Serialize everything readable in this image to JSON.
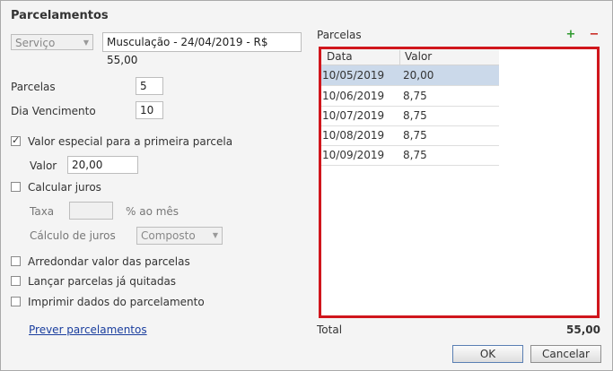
{
  "dialog": {
    "title": "Parcelamentos"
  },
  "form": {
    "servico_combo": "Serviço",
    "servico_desc": "Musculação - 24/04/2019 - R$ 55,00",
    "parcelas_label": "Parcelas",
    "parcelas_value": "5",
    "dia_vencimento_label": "Dia Vencimento",
    "dia_vencimento_value": "10",
    "valor_especial_label": "Valor especial para a primeira parcela",
    "valor_label": "Valor",
    "valor_value": "20,00",
    "calcular_juros_label": "Calcular juros",
    "taxa_label": "Taxa",
    "taxa_value": "",
    "taxa_unit": "% ao mês",
    "calculo_juros_label": "Cálculo de juros",
    "calculo_juros_value": "Composto",
    "arredondar_label": "Arredondar valor das parcelas",
    "lancar_label": "Lançar parcelas já quitadas",
    "imprimir_label": "Imprimir dados do parcelamento",
    "prever_link": "Prever parcelamentos"
  },
  "checkboxes": {
    "valor_especial": true,
    "calcular_juros": false,
    "arredondar": false,
    "lancar": false,
    "imprimir": false
  },
  "parcelas_panel": {
    "label": "Parcelas",
    "columns": [
      "Data",
      "Valor"
    ],
    "rows": [
      {
        "data": "10/05/2019",
        "valor": "20,00"
      },
      {
        "data": "10/06/2019",
        "valor": "8,75"
      },
      {
        "data": "10/07/2019",
        "valor": "8,75"
      },
      {
        "data": "10/08/2019",
        "valor": "8,75"
      },
      {
        "data": "10/09/2019",
        "valor": "8,75"
      }
    ],
    "selected_row": 0,
    "total_label": "Total",
    "total_value": "55,00",
    "add_icon": "plus-icon",
    "remove_icon": "minus-icon"
  },
  "buttons": {
    "ok": "OK",
    "cancel": "Cancelar"
  },
  "colors": {
    "highlight_border": "#d0161c",
    "selected_row": "#cbd9ea",
    "add_green": "#2e9a2e",
    "remove_red": "#c8221a",
    "link": "#1a3e9e"
  }
}
